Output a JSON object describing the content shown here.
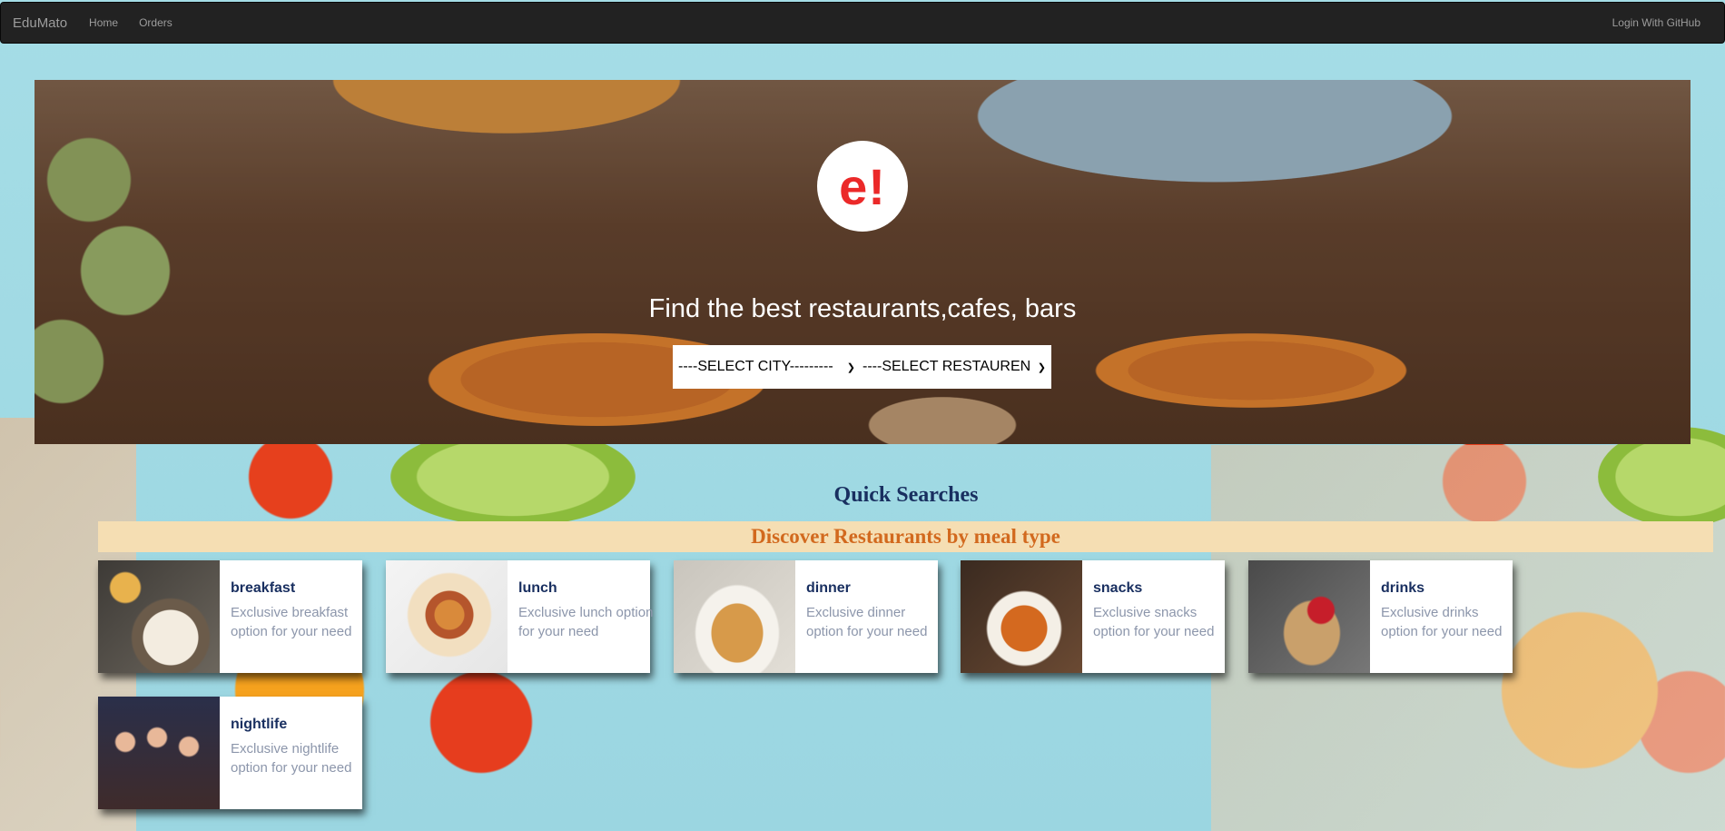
{
  "navbar": {
    "brand": "EduMato",
    "links": [
      "Home",
      "Orders"
    ],
    "login": "Login With GitHub"
  },
  "hero": {
    "logo": "e!",
    "title": "Find the best restaurants,cafes, bars",
    "city_select": "----SELECT CITY---------",
    "restaurant_select": "----SELECT RESTAUREN"
  },
  "quick_searches": {
    "title": "Quick Searches",
    "subtitle": "Discover Restaurants by meal type",
    "items": [
      {
        "title": "breakfast",
        "desc": "Exclusive breakfast option for your need"
      },
      {
        "title": "lunch",
        "desc": "Exclusive lunch option for your need"
      },
      {
        "title": "dinner",
        "desc": "Exclusive dinner option for your need"
      },
      {
        "title": "snacks",
        "desc": "Exclusive snacks option for your need"
      },
      {
        "title": "drinks",
        "desc": "Exclusive drinks option for your need"
      },
      {
        "title": "nightlife",
        "desc": "Exclusive nightlife option for your need"
      }
    ]
  }
}
